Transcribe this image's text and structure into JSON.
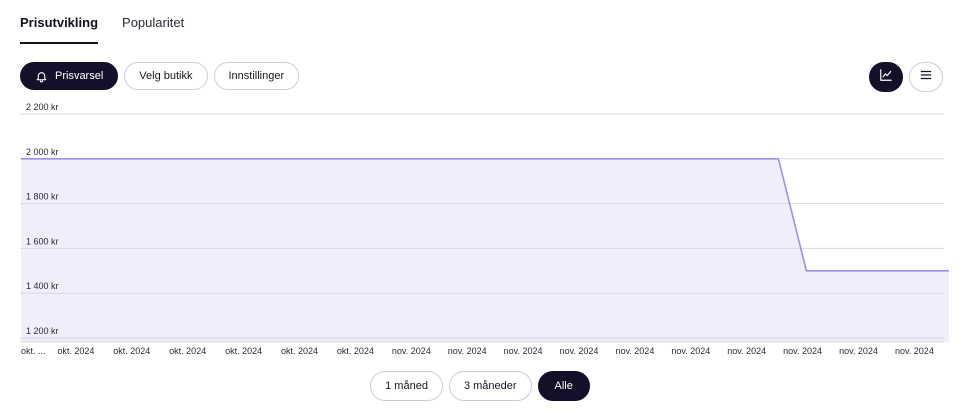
{
  "tabs": [
    {
      "label": "Prisutvikling",
      "active": true
    },
    {
      "label": "Popularitet",
      "active": false
    }
  ],
  "toolbar": {
    "alert_label": "Prisvarsel",
    "alert_icon": "bell-icon",
    "store_label": "Velg butikk",
    "settings_label": "Innstillinger"
  },
  "view_toggle": {
    "chart_icon": "line-chart-icon",
    "list_icon": "menu-icon",
    "selected": "chart"
  },
  "range_buttons": {
    "one_month": "1 måned",
    "three_months": "3 måneder",
    "all": "Alle",
    "selected": "all"
  },
  "colors": {
    "line": "#9d8ff0",
    "fill": "#f1eefc",
    "grid": "#d9d7de",
    "dark": "#15102a"
  },
  "chart_data": {
    "type": "area",
    "y_ticks": [
      "2 200 kr",
      "2 000 kr",
      "1 800 kr",
      "1 600 kr",
      "1 400 kr",
      "1 200 kr"
    ],
    "ylim": [
      1150,
      2250
    ],
    "x_ticks": [
      "okt. ...",
      "okt. 2024",
      "okt. 2024",
      "okt. 2024",
      "okt. 2024",
      "okt. 2024",
      "okt. 2024",
      "nov. 2024",
      "nov. 2024",
      "nov. 2024",
      "nov. 2024",
      "nov. 2024",
      "nov. 2024",
      "nov. 2024",
      "nov. 2024",
      "nov. 2024",
      "nov. 2024"
    ],
    "series": [
      {
        "points": [
          {
            "x": 0,
            "y": 2000
          },
          {
            "x": 13.55,
            "y": 2000
          },
          {
            "x": 14.05,
            "y": 1500
          },
          {
            "x": 16.6,
            "y": 1500
          }
        ]
      }
    ],
    "grid": true
  }
}
